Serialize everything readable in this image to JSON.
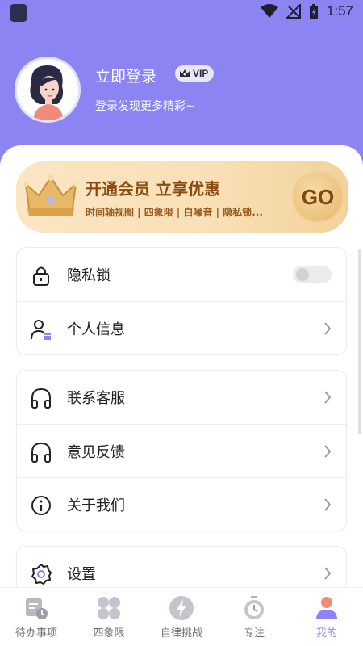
{
  "status_bar": {
    "time": "1:57"
  },
  "profile": {
    "login_title": "立即登录",
    "vip_badge": "VIP",
    "subtitle": "登录发现更多精彩~"
  },
  "vip_banner": {
    "title": "开通会员 立享优惠",
    "subtitle": "时间轴视图 | 四象限 | 白噪音 | 隐私锁...",
    "go_label": "GO"
  },
  "menu_groups": [
    [
      {
        "label": "隐私锁",
        "icon": "lock-icon",
        "control": "toggle",
        "toggle_on": false
      },
      {
        "label": "个人信息",
        "icon": "user-info-icon",
        "control": "chevron"
      }
    ],
    [
      {
        "label": "联系客服",
        "icon": "headphones-icon",
        "control": "chevron"
      },
      {
        "label": "意见反馈",
        "icon": "headphones-icon",
        "control": "chevron"
      },
      {
        "label": "关于我们",
        "icon": "info-circle-icon",
        "control": "chevron"
      }
    ],
    [
      {
        "label": "设置",
        "icon": "gear-icon",
        "control": "chevron"
      }
    ]
  ],
  "tabs": [
    {
      "label": "待办事项",
      "icon": "todo-icon",
      "active": false
    },
    {
      "label": "四象限",
      "icon": "quadrant-icon",
      "active": false
    },
    {
      "label": "自律挑战",
      "icon": "lightning-icon",
      "active": false
    },
    {
      "label": "专注",
      "icon": "stopwatch-icon",
      "active": false
    },
    {
      "label": "我的",
      "icon": "profile-icon",
      "active": true
    }
  ],
  "colors": {
    "accent": "#8c84f3",
    "banner_text": "#8a4b0e",
    "tab_inactive": "#6e6e78"
  }
}
